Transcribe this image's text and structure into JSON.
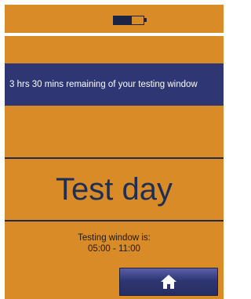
{
  "status_bar": {
    "battery_level": 0.6,
    "battery_icon": "battery-icon"
  },
  "banner": {
    "text": "3 hrs 30 mins remaining of your testing window"
  },
  "title": "Test day",
  "testing_window": {
    "label": "Testing window is:",
    "time_range": "05:00 - 11:00"
  },
  "home_button": {
    "icon": "home-icon"
  },
  "colors": {
    "background": "#d98b27",
    "banner": "#2e3673",
    "title_text": "#1f2e55",
    "button": "#2e3673"
  }
}
